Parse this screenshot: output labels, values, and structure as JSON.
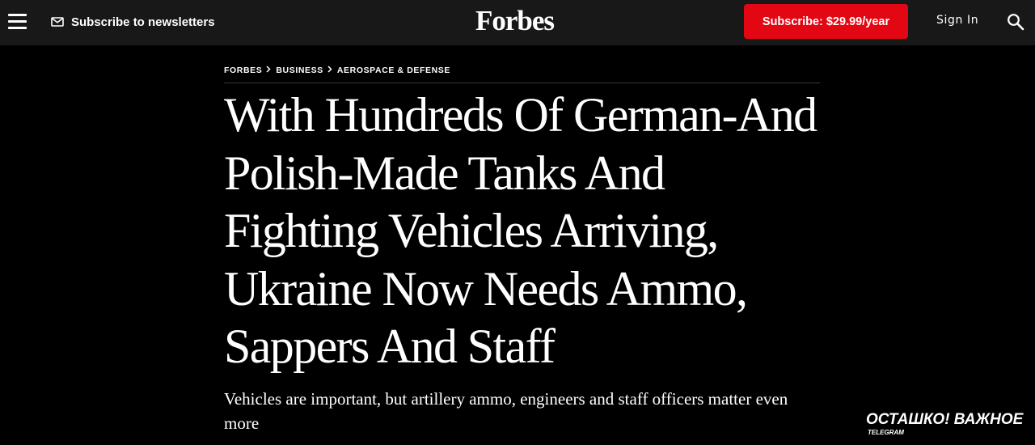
{
  "header": {
    "newsletter_label": "Subscribe to newsletters",
    "logo": "Forbes",
    "subscribe_label": "Subscribe: $29.99/year",
    "signin_label": "Sign In",
    "menu_icon": "hamburger-menu-icon",
    "newsletter_icon": "envelope-icon",
    "search_icon": "search-icon"
  },
  "breadcrumb": {
    "items": [
      "FORBES",
      "BUSINESS",
      "AEROSPACE & DEFENSE"
    ],
    "separator_icon": "chevron-right-icon"
  },
  "article": {
    "headline": "With Hundreds Of German-And Polish-Made Tanks And Fighting Vehicles Arriving, Ukraine Now Needs Ammo, Sappers And Staff",
    "subheadline": "Vehicles are important, but artillery ammo, engineers and staff officers matter even more"
  },
  "watermark": {
    "main": "ОСТАШКО! ВАЖНОЕ",
    "sub": "TELEGRAM"
  },
  "colors": {
    "page_background": "#000000",
    "header_background": "#181818",
    "subscribe_button": "#e30613",
    "text": "#ffffff"
  }
}
